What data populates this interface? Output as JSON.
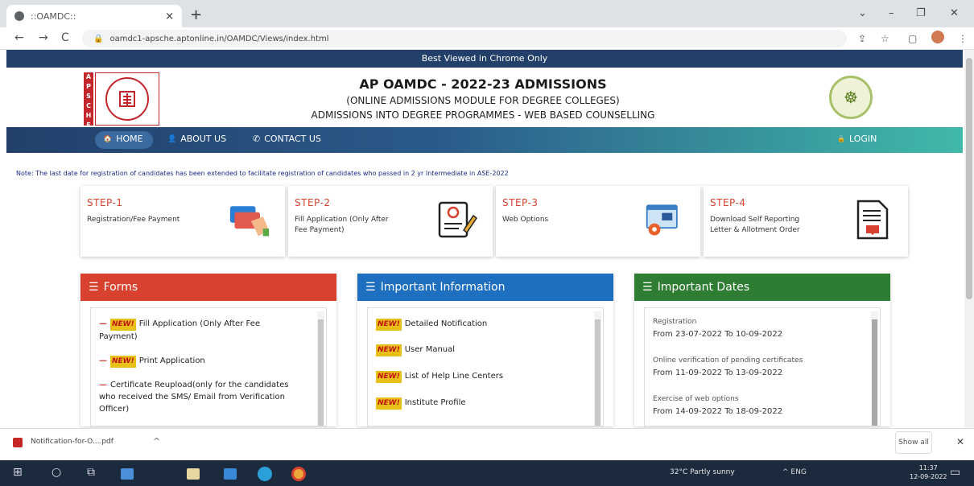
{
  "browser": {
    "tab_title": "::OAMDC::",
    "tab_close": "×",
    "new_tab": "+",
    "url": "oamdc1-apsche.aptonline.in/OAMDC/Views/index.html",
    "back": "←",
    "forward": "→",
    "reload": "C",
    "lock": "🔒",
    "share": "⇪",
    "star": "☆",
    "tabsearch": "▢",
    "menu": "⋮",
    "win_chevron": "⌄",
    "win_min": "–",
    "win_max": "❐",
    "win_close": "✕"
  },
  "banner": "Best Viewed in Chrome Only",
  "header": {
    "title": "AP OAMDC - 2022-23 ADMISSIONS",
    "subtitle1": "(ONLINE ADMISSIONS MODULE FOR DEGREE COLLEGES)",
    "subtitle2": "ADMISSIONS INTO DEGREE PROGRAMMES - WEB BASED COUNSELLING",
    "apsche": "A P S C H E"
  },
  "nav": {
    "home": "HOME",
    "about": "ABOUT US",
    "contact": "CONTACT US",
    "login": "LOGIN",
    "home_icon": "🏠",
    "about_icon": "👤",
    "contact_icon": "✆",
    "login_icon": "🔒"
  },
  "note": "Note: The last date for registration of candidates has been extended to facilitate registration of candidates who passed in 2 yr Intermediate in ASE-2022",
  "steps": [
    {
      "label": "STEP-1",
      "desc": "Registration/Fee Payment"
    },
    {
      "label": "STEP-2",
      "desc": "Fill Application (Only After Fee Payment)"
    },
    {
      "label": "STEP-3",
      "desc": "Web Options"
    },
    {
      "label": "STEP-4",
      "desc": "Download Self Reporting Letter & Allotment Order"
    }
  ],
  "panels": {
    "forms": {
      "title": "Forms",
      "items": [
        "Fill Application (Only After Fee Payment)",
        "Print Application",
        "Certificate Reupload(only for the candidates who received the SMS/ Email from Verification Officer)"
      ]
    },
    "info": {
      "title": "Important Information",
      "items": [
        "Detailed Notification",
        "User Manual",
        "List of Help Line Centers",
        "Institute Profile"
      ]
    },
    "dates": {
      "title": "Important Dates",
      "items": [
        {
          "label": "Registration",
          "value": "From 23-07-2022 To 10-09-2022"
        },
        {
          "label": "Online verification of pending certificates",
          "value": "From 11-09-2022 To 13-09-2022"
        },
        {
          "label": "Exercise of web options",
          "value": "From 14-09-2022 To 18-09-2022"
        }
      ]
    },
    "new_badge": "NEW!",
    "new_badge_small": "NEW!"
  },
  "download": {
    "filename": "Notification-for-O....pdf",
    "chevron": "^",
    "show_all": "Show all",
    "close": "✕"
  },
  "taskbar": {
    "weather": "32°C  Partly sunny",
    "tray": "^  ENG",
    "time": "11:37",
    "date": "12-09-2022"
  },
  "colors": {
    "banner": "#22406a",
    "forms_header": "#d9412f",
    "info_header": "#1e6fc0",
    "dates_header": "#2e7d32"
  }
}
